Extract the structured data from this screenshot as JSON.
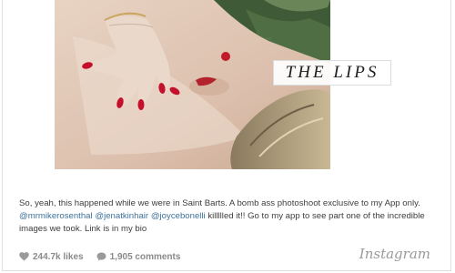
{
  "post": {
    "image_title": "THE LIPS",
    "caption": {
      "text_1": "So, yeah, this happened while we were in Saint Barts. A bomb ass photoshoot exclusive to my App only. ",
      "mentions": [
        "@mrmikerosenthal",
        "@jenatkinhair",
        "@joycebonelli"
      ],
      "text_2": " killllled it!! Go to my app to see part one of the incredible images we took. Link is in my bio"
    },
    "likes": "244.7k likes",
    "comments": "1,905 comments",
    "brand": "Instagram"
  },
  "icons": {
    "likes": "heart-icon",
    "comments": "comment-bubble-icon"
  },
  "colors": {
    "mention": "#3f729b",
    "nail_polish": "#c4102c",
    "stats": "#8a8a8a"
  }
}
